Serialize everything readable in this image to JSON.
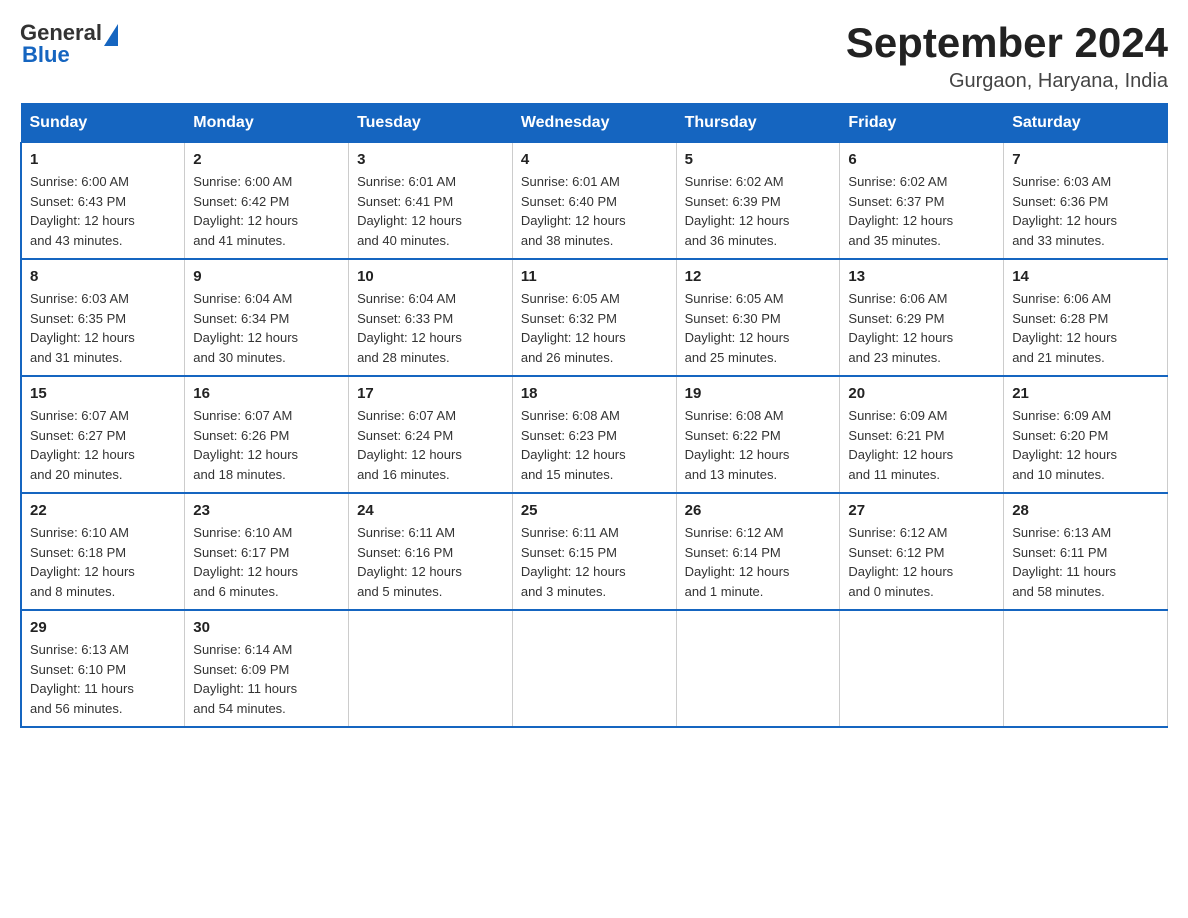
{
  "header": {
    "logo_general": "General",
    "logo_blue": "Blue",
    "title": "September 2024",
    "location": "Gurgaon, Haryana, India"
  },
  "days_of_week": [
    "Sunday",
    "Monday",
    "Tuesday",
    "Wednesday",
    "Thursday",
    "Friday",
    "Saturday"
  ],
  "weeks": [
    [
      {
        "day": "1",
        "sunrise": "6:00 AM",
        "sunset": "6:43 PM",
        "daylight": "12 hours and 43 minutes."
      },
      {
        "day": "2",
        "sunrise": "6:00 AM",
        "sunset": "6:42 PM",
        "daylight": "12 hours and 41 minutes."
      },
      {
        "day": "3",
        "sunrise": "6:01 AM",
        "sunset": "6:41 PM",
        "daylight": "12 hours and 40 minutes."
      },
      {
        "day": "4",
        "sunrise": "6:01 AM",
        "sunset": "6:40 PM",
        "daylight": "12 hours and 38 minutes."
      },
      {
        "day": "5",
        "sunrise": "6:02 AM",
        "sunset": "6:39 PM",
        "daylight": "12 hours and 36 minutes."
      },
      {
        "day": "6",
        "sunrise": "6:02 AM",
        "sunset": "6:37 PM",
        "daylight": "12 hours and 35 minutes."
      },
      {
        "day": "7",
        "sunrise": "6:03 AM",
        "sunset": "6:36 PM",
        "daylight": "12 hours and 33 minutes."
      }
    ],
    [
      {
        "day": "8",
        "sunrise": "6:03 AM",
        "sunset": "6:35 PM",
        "daylight": "12 hours and 31 minutes."
      },
      {
        "day": "9",
        "sunrise": "6:04 AM",
        "sunset": "6:34 PM",
        "daylight": "12 hours and 30 minutes."
      },
      {
        "day": "10",
        "sunrise": "6:04 AM",
        "sunset": "6:33 PM",
        "daylight": "12 hours and 28 minutes."
      },
      {
        "day": "11",
        "sunrise": "6:05 AM",
        "sunset": "6:32 PM",
        "daylight": "12 hours and 26 minutes."
      },
      {
        "day": "12",
        "sunrise": "6:05 AM",
        "sunset": "6:30 PM",
        "daylight": "12 hours and 25 minutes."
      },
      {
        "day": "13",
        "sunrise": "6:06 AM",
        "sunset": "6:29 PM",
        "daylight": "12 hours and 23 minutes."
      },
      {
        "day": "14",
        "sunrise": "6:06 AM",
        "sunset": "6:28 PM",
        "daylight": "12 hours and 21 minutes."
      }
    ],
    [
      {
        "day": "15",
        "sunrise": "6:07 AM",
        "sunset": "6:27 PM",
        "daylight": "12 hours and 20 minutes."
      },
      {
        "day": "16",
        "sunrise": "6:07 AM",
        "sunset": "6:26 PM",
        "daylight": "12 hours and 18 minutes."
      },
      {
        "day": "17",
        "sunrise": "6:07 AM",
        "sunset": "6:24 PM",
        "daylight": "12 hours and 16 minutes."
      },
      {
        "day": "18",
        "sunrise": "6:08 AM",
        "sunset": "6:23 PM",
        "daylight": "12 hours and 15 minutes."
      },
      {
        "day": "19",
        "sunrise": "6:08 AM",
        "sunset": "6:22 PM",
        "daylight": "12 hours and 13 minutes."
      },
      {
        "day": "20",
        "sunrise": "6:09 AM",
        "sunset": "6:21 PM",
        "daylight": "12 hours and 11 minutes."
      },
      {
        "day": "21",
        "sunrise": "6:09 AM",
        "sunset": "6:20 PM",
        "daylight": "12 hours and 10 minutes."
      }
    ],
    [
      {
        "day": "22",
        "sunrise": "6:10 AM",
        "sunset": "6:18 PM",
        "daylight": "12 hours and 8 minutes."
      },
      {
        "day": "23",
        "sunrise": "6:10 AM",
        "sunset": "6:17 PM",
        "daylight": "12 hours and 6 minutes."
      },
      {
        "day": "24",
        "sunrise": "6:11 AM",
        "sunset": "6:16 PM",
        "daylight": "12 hours and 5 minutes."
      },
      {
        "day": "25",
        "sunrise": "6:11 AM",
        "sunset": "6:15 PM",
        "daylight": "12 hours and 3 minutes."
      },
      {
        "day": "26",
        "sunrise": "6:12 AM",
        "sunset": "6:14 PM",
        "daylight": "12 hours and 1 minute."
      },
      {
        "day": "27",
        "sunrise": "6:12 AM",
        "sunset": "6:12 PM",
        "daylight": "12 hours and 0 minutes."
      },
      {
        "day": "28",
        "sunrise": "6:13 AM",
        "sunset": "6:11 PM",
        "daylight": "11 hours and 58 minutes."
      }
    ],
    [
      {
        "day": "29",
        "sunrise": "6:13 AM",
        "sunset": "6:10 PM",
        "daylight": "11 hours and 56 minutes."
      },
      {
        "day": "30",
        "sunrise": "6:14 AM",
        "sunset": "6:09 PM",
        "daylight": "11 hours and 54 minutes."
      },
      null,
      null,
      null,
      null,
      null
    ]
  ],
  "labels": {
    "sunrise": "Sunrise:",
    "sunset": "Sunset:",
    "daylight": "Daylight:"
  }
}
